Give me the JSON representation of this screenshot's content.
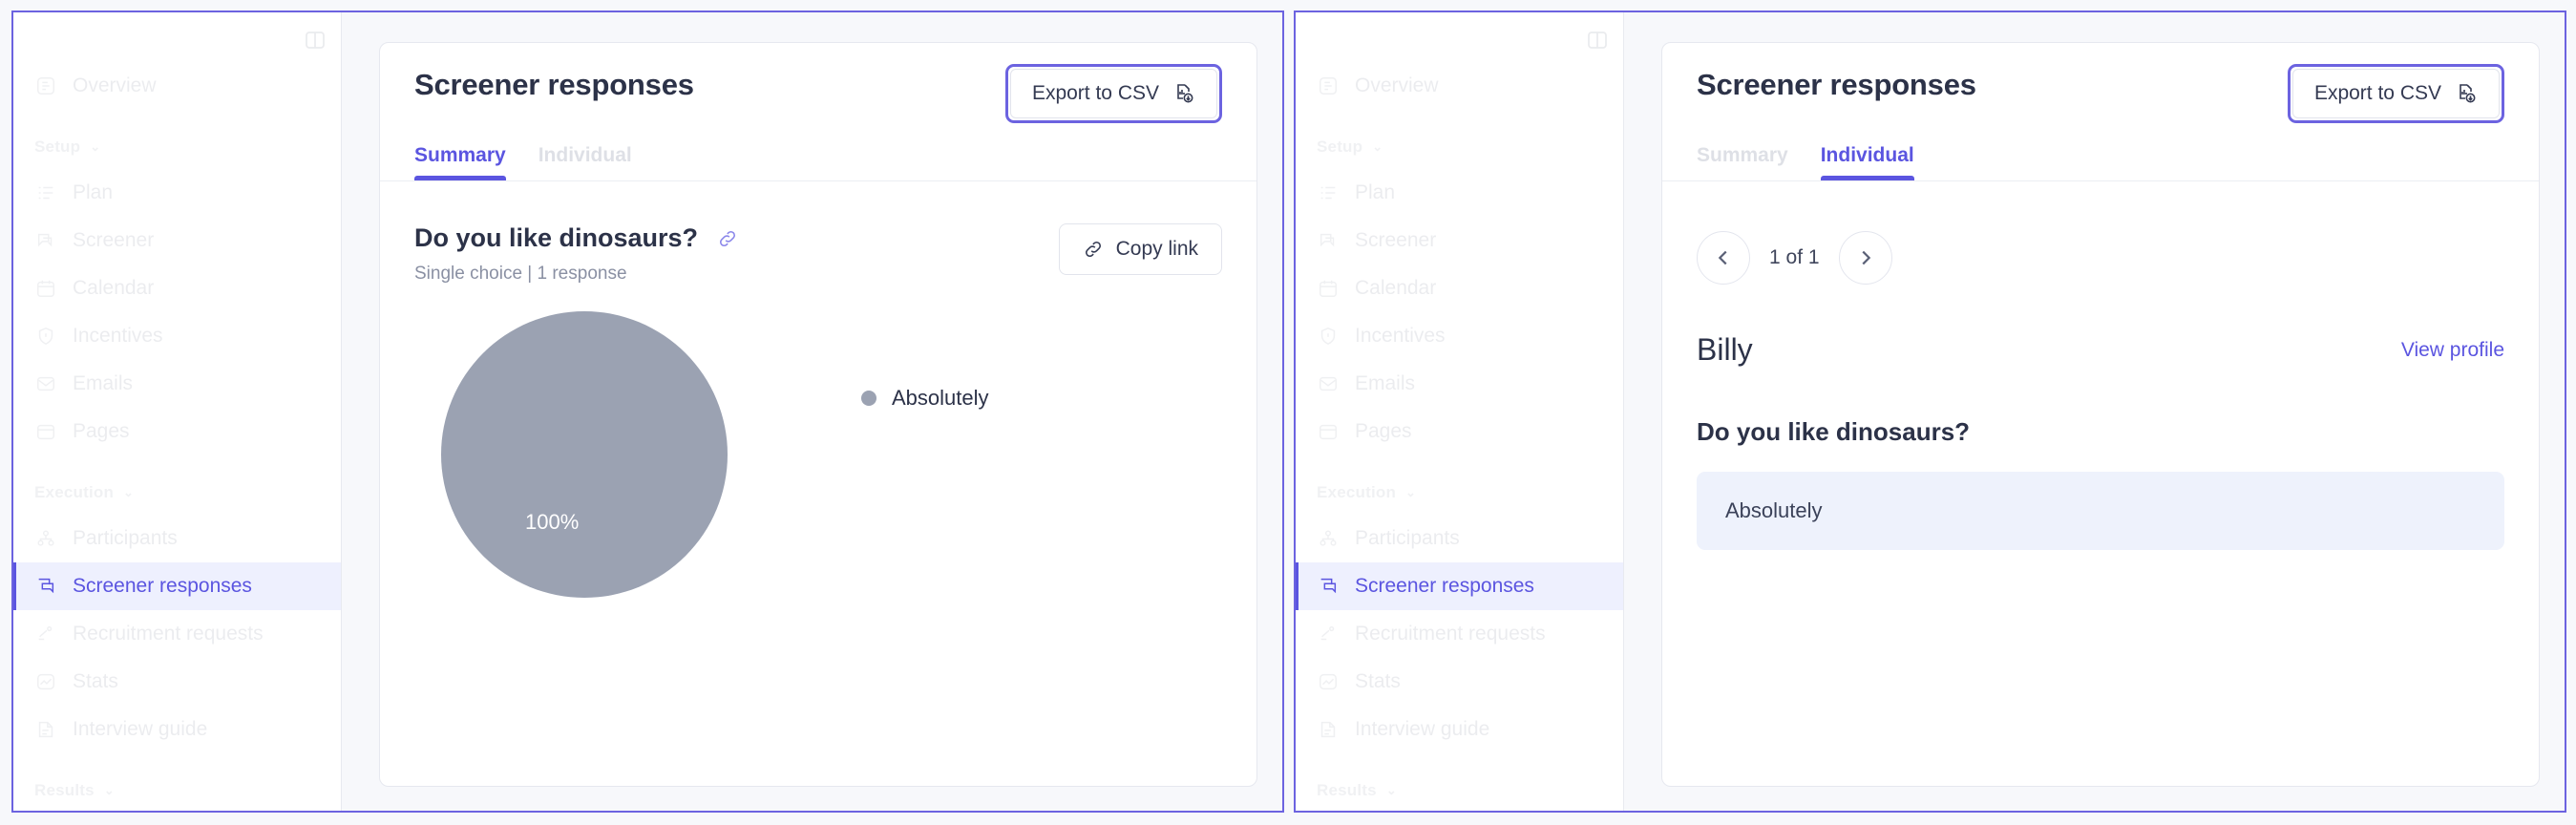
{
  "theme": {
    "accent": "#5b55e0",
    "focus_ring": "#6c63e0",
    "pie_color": "#9ba2b2",
    "answer_bg": "#eef2fc",
    "active_nav_bg": "#eef0fe",
    "page_bg": "#f7f8fb"
  },
  "sidebar": {
    "toggle_icon": "panel-toggle-icon",
    "top_items": [
      {
        "label": "Overview",
        "icon": "overview-icon"
      }
    ],
    "sections": [
      {
        "label": "Setup",
        "caret": "⌄",
        "items": [
          {
            "label": "Plan",
            "icon": "list-icon"
          },
          {
            "label": "Screener",
            "icon": "screener-icon"
          },
          {
            "label": "Calendar",
            "icon": "calendar-icon"
          },
          {
            "label": "Incentives",
            "icon": "shield-icon"
          },
          {
            "label": "Emails",
            "icon": "envelope-icon"
          },
          {
            "label": "Pages",
            "icon": "page-icon"
          }
        ]
      },
      {
        "label": "Execution",
        "caret": "⌄",
        "items": [
          {
            "label": "Participants",
            "icon": "participants-icon"
          },
          {
            "label": "Screener responses",
            "icon": "screener-responses-icon",
            "active": true
          },
          {
            "label": "Recruitment requests",
            "icon": "recruitment-icon"
          },
          {
            "label": "Stats",
            "icon": "stats-icon"
          },
          {
            "label": "Interview guide",
            "icon": "guide-icon"
          }
        ]
      },
      {
        "label": "Results",
        "caret": "⌄",
        "items": []
      }
    ]
  },
  "panels": {
    "left": {
      "title": "Screener responses",
      "export_label": "Export to CSV",
      "export_icon": "csv-download-icon",
      "tabs": [
        {
          "label": "Summary",
          "active": true
        },
        {
          "label": "Individual",
          "active": false
        }
      ],
      "summary": {
        "question": "Do you like dinosaurs?",
        "question_link_icon": "link-icon",
        "meta": "Single choice | 1 response",
        "copy_link_label": "Copy link",
        "copy_link_icon": "link-icon"
      }
    },
    "right": {
      "title": "Screener responses",
      "export_label": "Export to CSV",
      "export_icon": "csv-download-icon",
      "tabs": [
        {
          "label": "Summary",
          "active": false
        },
        {
          "label": "Individual",
          "active": true
        }
      ],
      "individual": {
        "prev_icon": "chevron-left-icon",
        "next_icon": "chevron-right-icon",
        "pager_text": "1 of 1",
        "person_name": "Billy",
        "view_profile_label": "View profile",
        "question": "Do you like dinosaurs?",
        "answer": "Absolutely"
      }
    }
  },
  "chart_data": {
    "type": "pie",
    "title": "Do you like dinosaurs?",
    "subtitle": "Single choice | 1 response",
    "categories": [
      "Absolutely"
    ],
    "values": [
      100
    ],
    "value_labels": [
      "100%"
    ],
    "colors": [
      "#9ba2b2"
    ],
    "legend": [
      "Absolutely"
    ],
    "legend_position": "right",
    "total_responses": 1,
    "units": "percent"
  }
}
